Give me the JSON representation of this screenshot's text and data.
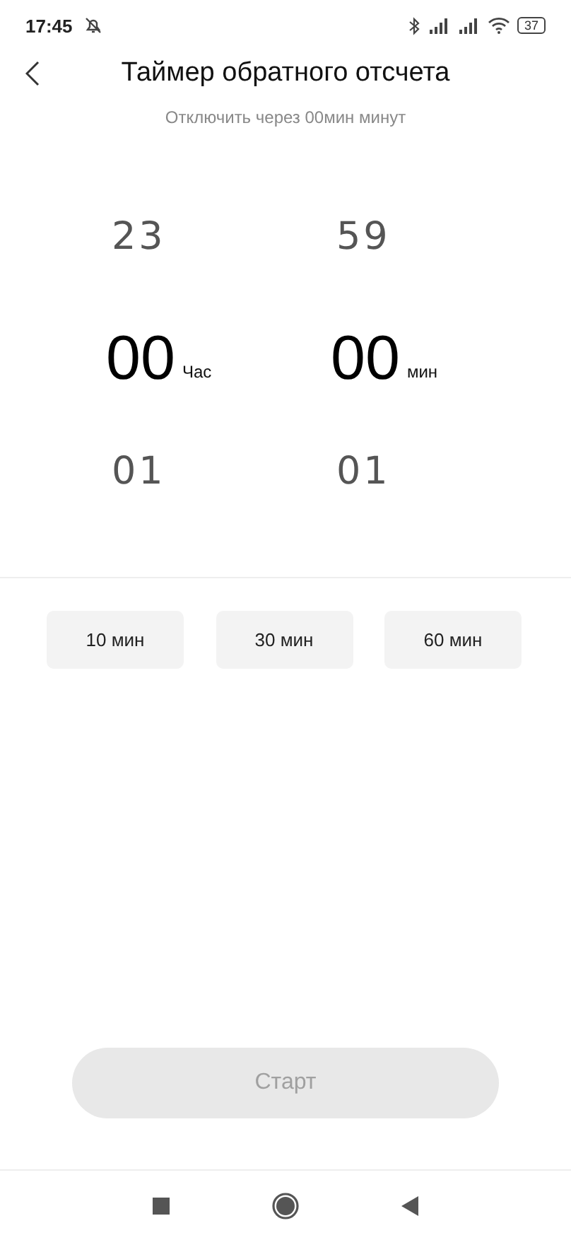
{
  "status_bar": {
    "time": "17:45",
    "battery": "37"
  },
  "header": {
    "title": "Таймер обратного отсчета"
  },
  "subtitle": "Отключить через 00мин минут",
  "picker": {
    "columns": [
      {
        "above": "23",
        "value": "00",
        "unit": "Час",
        "below": "01"
      },
      {
        "above": "59",
        "value": "00",
        "unit": "мин",
        "below": "01"
      }
    ]
  },
  "presets": [
    {
      "label": "10 мин"
    },
    {
      "label": "30 мин"
    },
    {
      "label": "60 мин"
    }
  ],
  "start_button": {
    "label": "Старт",
    "disabled": true
  }
}
